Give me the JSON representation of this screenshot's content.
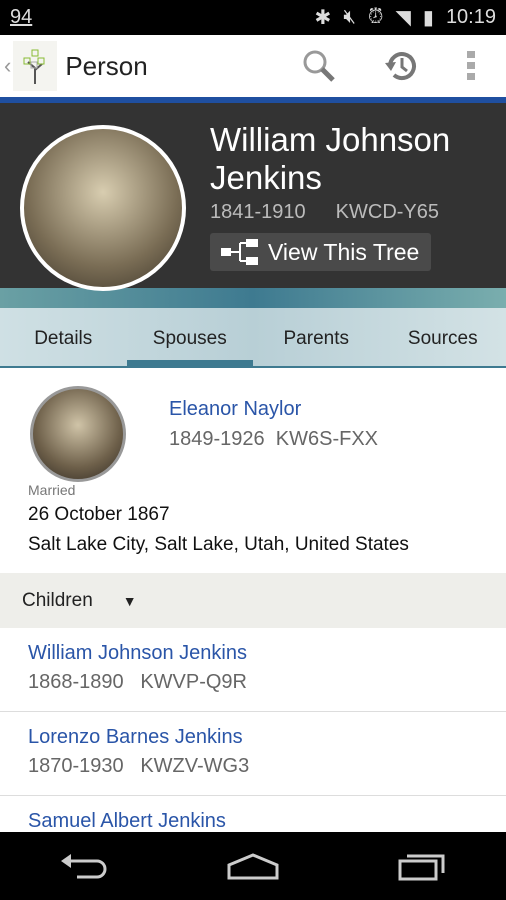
{
  "status": {
    "left": "94",
    "time": "10:19"
  },
  "appbar": {
    "title": "Person"
  },
  "person": {
    "name": "William Johnson Jenkins",
    "years": "1841-1910",
    "id": "KWCD-Y65",
    "view_tree": "View This Tree"
  },
  "tabs": [
    {
      "label": "Details"
    },
    {
      "label": "Spouses"
    },
    {
      "label": "Parents"
    },
    {
      "label": "Sources"
    }
  ],
  "spouse": {
    "name": "Eleanor Naylor",
    "years": "1849-1926",
    "id": "KW6S-FXX",
    "married_label": "Married",
    "date": "26 October 1867",
    "place": "Salt Lake City, Salt Lake, Utah, United States"
  },
  "children": {
    "label": "Children",
    "items": [
      {
        "name": "William Johnson Jenkins",
        "info": "1868-1890   KWVP-Q9R"
      },
      {
        "name": "Lorenzo Barnes Jenkins",
        "info": "1870-1930   KWZV-WG3"
      },
      {
        "name": "Samuel Albert Jenkins",
        "info": ""
      }
    ]
  },
  "colors": {
    "accent": "#1f4fa0",
    "link": "#2a55a8",
    "tab": "#3e7a90"
  }
}
